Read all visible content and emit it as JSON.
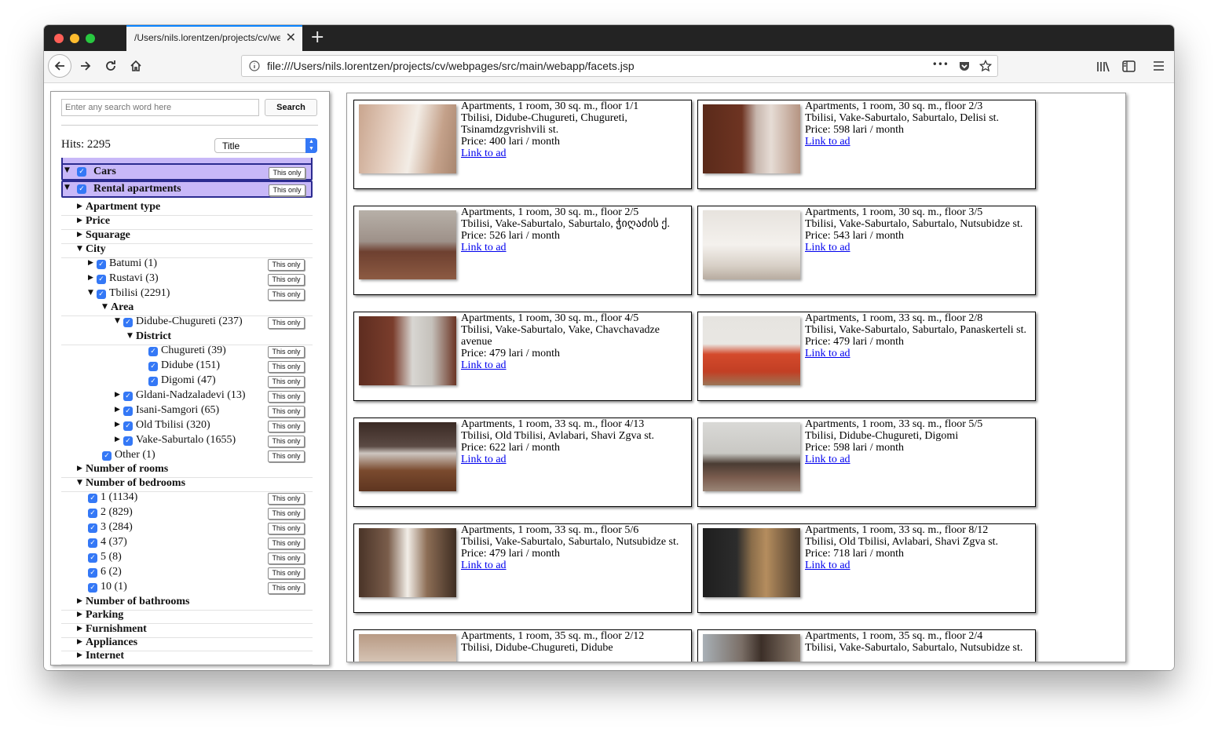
{
  "browser": {
    "tab_title": "/Users/nils.lorentzen/projects/cv/webpages/src/main/webapp/facets.jsp",
    "url": "file:///Users/nils.lorentzen/projects/cv/webpages/src/main/webapp/facets.jsp",
    "new_tab": "+",
    "close": "✕",
    "more": "•••"
  },
  "search": {
    "placeholder": "Enter any search word here",
    "button": "Search"
  },
  "hits_label": "Hits: 2295",
  "sort": {
    "selected": "Title"
  },
  "this_only": "This only",
  "facets": [
    {
      "label": "Cars",
      "purple": true,
      "checked": true,
      "expanded": true,
      "level": 0
    },
    {
      "label": "Rental apartments",
      "purple": true,
      "checked": true,
      "expanded": true,
      "level": 0
    },
    {
      "label": "Apartment type",
      "head": true,
      "expanded": false,
      "level": 1
    },
    {
      "label": "Price",
      "head": true,
      "expanded": false,
      "level": 1
    },
    {
      "label": "Squarage",
      "head": true,
      "expanded": false,
      "level": 1
    },
    {
      "label": "City",
      "head": true,
      "expanded": true,
      "level": 1
    },
    {
      "label": "Batumi (1)",
      "checked": true,
      "expanded": false,
      "level": 2
    },
    {
      "label": "Rustavi (3)",
      "checked": true,
      "expanded": false,
      "level": 2
    },
    {
      "label": "Tbilisi (2291)",
      "checked": true,
      "expanded": true,
      "level": 2
    },
    {
      "label": "Area",
      "head": true,
      "expanded": true,
      "level": 3
    },
    {
      "label": "Didube-Chugureti (237)",
      "checked": true,
      "expanded": true,
      "level": 4
    },
    {
      "label": "District",
      "head": true,
      "expanded": true,
      "level": 5
    },
    {
      "label": "Chugureti (39)",
      "checked": true,
      "level": 6
    },
    {
      "label": "Didube (151)",
      "checked": true,
      "level": 6
    },
    {
      "label": "Digomi (47)",
      "checked": true,
      "level": 6
    },
    {
      "label": "Gldani-Nadzaladevi (13)",
      "checked": true,
      "expanded": false,
      "level": 4
    },
    {
      "label": "Isani-Samgori (65)",
      "checked": true,
      "expanded": false,
      "level": 4
    },
    {
      "label": "Old Tbilisi (320)",
      "checked": true,
      "expanded": false,
      "level": 4
    },
    {
      "label": "Vake-Saburtalo (1655)",
      "checked": true,
      "expanded": false,
      "level": 4
    },
    {
      "label": "Other (1)",
      "checked": true,
      "level": 3
    },
    {
      "label": "Number of rooms",
      "head": true,
      "expanded": false,
      "level": 1
    },
    {
      "label": "Number of bedrooms",
      "head": true,
      "expanded": true,
      "level": 1
    },
    {
      "label": "1 (1134)",
      "checked": true,
      "level": 2
    },
    {
      "label": "2 (829)",
      "checked": true,
      "level": 2
    },
    {
      "label": "3 (284)",
      "checked": true,
      "level": 2
    },
    {
      "label": "4 (37)",
      "checked": true,
      "level": 2
    },
    {
      "label": "5 (8)",
      "checked": true,
      "level": 2
    },
    {
      "label": "6 (2)",
      "checked": true,
      "level": 2
    },
    {
      "label": "10 (1)",
      "checked": true,
      "level": 2
    },
    {
      "label": "Number of bathrooms",
      "head": true,
      "expanded": false,
      "level": 1
    },
    {
      "label": "Parking",
      "head": true,
      "expanded": false,
      "level": 1
    },
    {
      "label": "Furnishment",
      "head": true,
      "expanded": false,
      "level": 1
    },
    {
      "label": "Appliances",
      "head": true,
      "expanded": false,
      "level": 1
    },
    {
      "label": "Internet",
      "head": true,
      "expanded": false,
      "level": 1
    }
  ],
  "results": [
    {
      "title": "Apartments, 1 room, 30 sq. m., floor 1/1",
      "address": "Tbilisi, Didube-Chugureti, Chugureti, Tsinamdzgvrishvili st.",
      "price": "Price: 400 lari / month",
      "link": "Link to ad",
      "photo": "bathroom"
    },
    {
      "title": "Apartments, 1 room, 30 sq. m., floor 2/3",
      "address": "Tbilisi, Vake-Saburtalo, Saburtalo, Delisi st.",
      "price": "Price: 598 lari / month",
      "link": "Link to ad",
      "photo": "wardrobe"
    },
    {
      "title": "Apartments, 1 room, 30 sq. m., floor 2/5",
      "address": "Tbilisi, Vake-Saburtalo, Saburtalo, ჭიღაძის ქ.",
      "price": "Price: 526 lari / month",
      "link": "Link to ad",
      "photo": "bedroom"
    },
    {
      "title": "Apartments, 1 room, 30 sq. m., floor 3/5",
      "address": "Tbilisi, Vake-Saburtalo, Saburtalo, Nutsubidze st.",
      "price": "Price: 543 lari / month",
      "link": "Link to ad",
      "photo": "sink"
    },
    {
      "title": "Apartments, 1 room, 30 sq. m., floor 4/5",
      "address": "Tbilisi, Vake-Saburtalo, Vake, Chavchavadze avenue",
      "price": "Price: 479 lari / month",
      "link": "Link to ad",
      "photo": "hallway"
    },
    {
      "title": "Apartments, 1 room, 33 sq. m., floor 2/8",
      "address": "Tbilisi, Vake-Saburtalo, Saburtalo, Panaskerteli st.",
      "price": "Price: 479 lari / month",
      "link": "Link to ad",
      "photo": "sofa"
    },
    {
      "title": "Apartments, 1 room, 33 sq. m., floor 4/13",
      "address": "Tbilisi, Old Tbilisi, Avlabari, Shavi Zgva st.",
      "price": "Price: 622 lari / month",
      "link": "Link to ad",
      "photo": "floor"
    },
    {
      "title": "Apartments, 1 room, 33 sq. m., floor 5/5",
      "address": "Tbilisi, Didube-Chugureti, Digomi",
      "price": "Price: 598 lari / month",
      "link": "Link to ad",
      "photo": "livingroom"
    },
    {
      "title": "Apartments, 1 room, 33 sq. m., floor 5/6",
      "address": "Tbilisi, Vake-Saburtalo, Saburtalo, Nutsubidze st.",
      "price": "Price: 479 lari / month",
      "link": "Link to ad",
      "photo": "room"
    },
    {
      "title": "Apartments, 1 room, 33 sq. m., floor 8/12",
      "address": "Tbilisi, Old Tbilisi, Avlabari, Shavi Zgva st.",
      "price": "Price: 718 lari / month",
      "link": "Link to ad",
      "photo": "dark"
    },
    {
      "title": "Apartments, 1 room, 35 sq. m., floor 2/12",
      "address": "Tbilisi, Didube-Chugureti, Didube",
      "price": "",
      "link": "",
      "photo": "wall"
    },
    {
      "title": "Apartments, 1 room, 35 sq. m., floor 2/4",
      "address": "Tbilisi, Vake-Saburtalo, Saburtalo, Nutsubidze st.",
      "price": "",
      "link": "",
      "photo": "wallpaper"
    }
  ]
}
